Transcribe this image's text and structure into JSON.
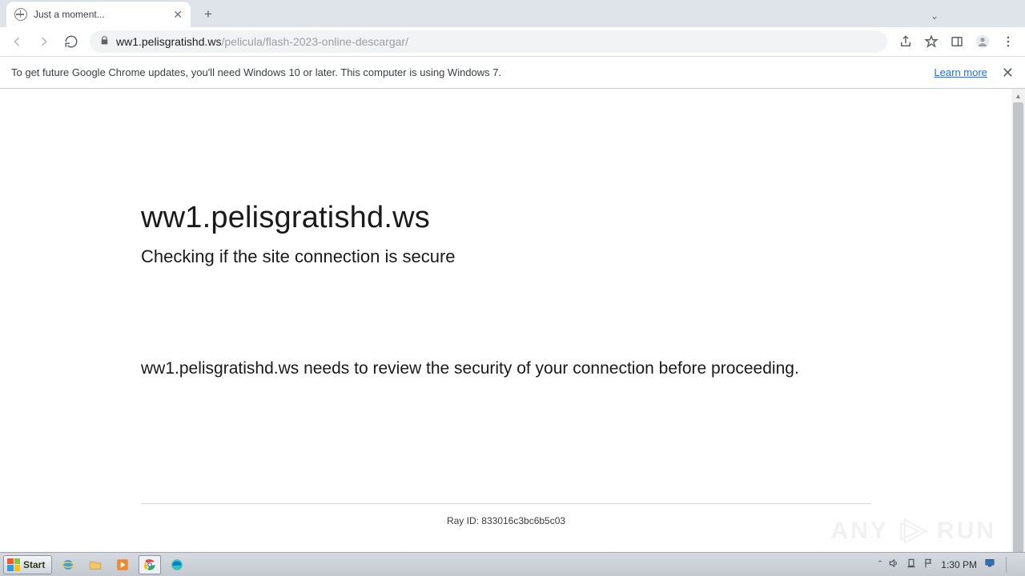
{
  "window": {
    "controls": {
      "min": "—",
      "max": "❐",
      "close": "✕"
    }
  },
  "browser": {
    "tab": {
      "title": "Just a moment..."
    },
    "nav": {
      "url_host": "ww1.pelisgratishd.ws",
      "url_path": "/pelicula/flash-2023-online-descargar/"
    },
    "infobar": {
      "message": "To get future Google Chrome updates, you'll need Windows 10 or later. This computer is using Windows 7.",
      "learn_more": "Learn more"
    }
  },
  "page": {
    "heading": "ww1.pelisgratishd.ws",
    "subheading": "Checking if the site connection is secure",
    "body": "ww1.pelisgratishd.ws needs to review the security of your connection before proceeding.",
    "ray_label": "Ray ID:",
    "ray_value": "833016c3bc6b5c03"
  },
  "watermark": {
    "left": "ANY",
    "right": "RUN"
  },
  "taskbar": {
    "start": "Start",
    "clock": "1:30 PM"
  }
}
